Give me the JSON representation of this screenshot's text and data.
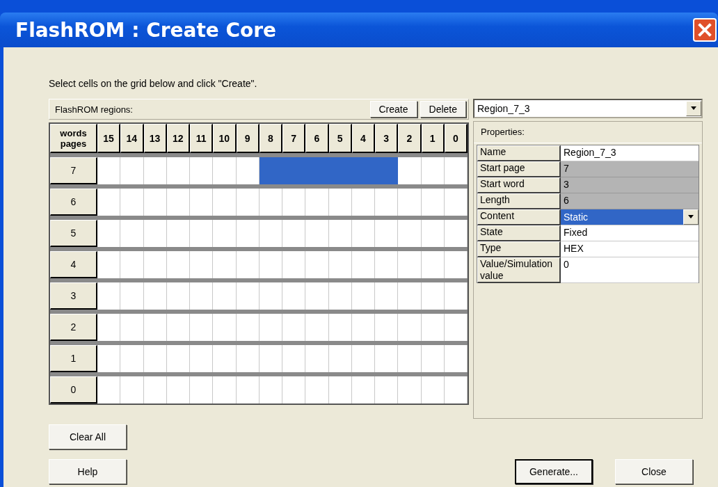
{
  "window": {
    "title": "FlashROM : Create Core"
  },
  "instruction": "Select cells on the grid below and click \"Create\".",
  "regions_bar": {
    "label": "FlashROM regions:",
    "buttons": [
      "Create",
      "Delete"
    ]
  },
  "region_select": {
    "value": "Region_7_3"
  },
  "grid": {
    "corner_top": "words",
    "corner_bottom": "pages",
    "columns": [
      "15",
      "14",
      "13",
      "12",
      "11",
      "10",
      "9",
      "8",
      "7",
      "6",
      "5",
      "4",
      "3",
      "2",
      "1",
      "0"
    ],
    "rows": [
      {
        "label": "7",
        "cells": [
          {
            "selected": false
          },
          {
            "selected": false
          },
          {
            "selected": false
          },
          {
            "selected": false
          },
          {
            "selected": false
          },
          {
            "selected": false
          },
          {
            "selected": false
          },
          {
            "selected": true
          },
          {
            "selected": true
          },
          {
            "selected": true
          },
          {
            "selected": true
          },
          {
            "selected": true
          },
          {
            "selected": true
          },
          {
            "selected": false
          },
          {
            "selected": false
          },
          {
            "selected": false
          }
        ]
      },
      {
        "label": "6",
        "cells": [
          {
            "selected": false
          },
          {
            "selected": false
          },
          {
            "selected": false
          },
          {
            "selected": false
          },
          {
            "selected": false
          },
          {
            "selected": false
          },
          {
            "selected": false
          },
          {
            "selected": false
          },
          {
            "selected": false
          },
          {
            "selected": false
          },
          {
            "selected": false
          },
          {
            "selected": false
          },
          {
            "selected": false
          },
          {
            "selected": false
          },
          {
            "selected": false
          },
          {
            "selected": false
          }
        ]
      },
      {
        "label": "5",
        "cells": [
          {
            "selected": false
          },
          {
            "selected": false
          },
          {
            "selected": false
          },
          {
            "selected": false
          },
          {
            "selected": false
          },
          {
            "selected": false
          },
          {
            "selected": false
          },
          {
            "selected": false
          },
          {
            "selected": false
          },
          {
            "selected": false
          },
          {
            "selected": false
          },
          {
            "selected": false
          },
          {
            "selected": false
          },
          {
            "selected": false
          },
          {
            "selected": false
          },
          {
            "selected": false
          }
        ]
      },
      {
        "label": "4",
        "cells": [
          {
            "selected": false
          },
          {
            "selected": false
          },
          {
            "selected": false
          },
          {
            "selected": false
          },
          {
            "selected": false
          },
          {
            "selected": false
          },
          {
            "selected": false
          },
          {
            "selected": false
          },
          {
            "selected": false
          },
          {
            "selected": false
          },
          {
            "selected": false
          },
          {
            "selected": false
          },
          {
            "selected": false
          },
          {
            "selected": false
          },
          {
            "selected": false
          },
          {
            "selected": false
          }
        ]
      },
      {
        "label": "3",
        "cells": [
          {
            "selected": false
          },
          {
            "selected": false
          },
          {
            "selected": false
          },
          {
            "selected": false
          },
          {
            "selected": false
          },
          {
            "selected": false
          },
          {
            "selected": false
          },
          {
            "selected": false
          },
          {
            "selected": false
          },
          {
            "selected": false
          },
          {
            "selected": false
          },
          {
            "selected": false
          },
          {
            "selected": false
          },
          {
            "selected": false
          },
          {
            "selected": false
          },
          {
            "selected": false
          }
        ]
      },
      {
        "label": "2",
        "cells": [
          {
            "selected": false
          },
          {
            "selected": false
          },
          {
            "selected": false
          },
          {
            "selected": false
          },
          {
            "selected": false
          },
          {
            "selected": false
          },
          {
            "selected": false
          },
          {
            "selected": false
          },
          {
            "selected": false
          },
          {
            "selected": false
          },
          {
            "selected": false
          },
          {
            "selected": false
          },
          {
            "selected": false
          },
          {
            "selected": false
          },
          {
            "selected": false
          },
          {
            "selected": false
          }
        ]
      },
      {
        "label": "1",
        "cells": [
          {
            "selected": false
          },
          {
            "selected": false
          },
          {
            "selected": false
          },
          {
            "selected": false
          },
          {
            "selected": false
          },
          {
            "selected": false
          },
          {
            "selected": false
          },
          {
            "selected": false
          },
          {
            "selected": false
          },
          {
            "selected": false
          },
          {
            "selected": false
          },
          {
            "selected": false
          },
          {
            "selected": false
          },
          {
            "selected": false
          },
          {
            "selected": false
          },
          {
            "selected": false
          }
        ]
      },
      {
        "label": "0",
        "cells": [
          {
            "selected": false
          },
          {
            "selected": false
          },
          {
            "selected": false
          },
          {
            "selected": false
          },
          {
            "selected": false
          },
          {
            "selected": false
          },
          {
            "selected": false
          },
          {
            "selected": false
          },
          {
            "selected": false
          },
          {
            "selected": false
          },
          {
            "selected": false
          },
          {
            "selected": false
          },
          {
            "selected": false
          },
          {
            "selected": false
          },
          {
            "selected": false
          },
          {
            "selected": false
          }
        ]
      }
    ]
  },
  "properties": {
    "title": "Properties:",
    "rows": [
      {
        "name": "Name",
        "value": "Region_7_3",
        "kind": "text"
      },
      {
        "name": "Start page",
        "value": "7",
        "kind": "readonly"
      },
      {
        "name": "Start word",
        "value": "3",
        "kind": "readonly"
      },
      {
        "name": "Length",
        "value": "6",
        "kind": "readonly"
      },
      {
        "name": "Content",
        "value": "Static",
        "kind": "dropdown"
      },
      {
        "name": "State",
        "value": "Fixed",
        "kind": "text"
      },
      {
        "name": "Type",
        "value": "HEX",
        "kind": "text"
      },
      {
        "name": "Value/Simulation value",
        "value": "0",
        "kind": "text"
      }
    ]
  },
  "buttons": {
    "clear": "Clear All",
    "help": "Help",
    "generate": "Generate...",
    "close": "Close"
  }
}
